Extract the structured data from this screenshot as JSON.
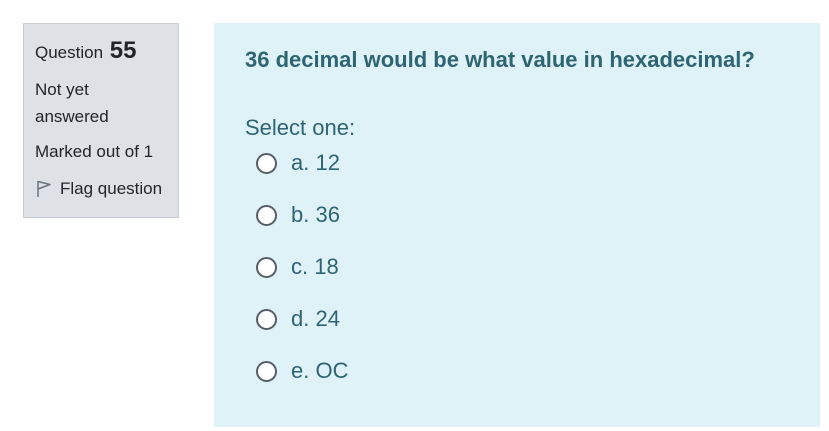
{
  "info": {
    "question_label": "Question",
    "question_number": "55",
    "state": "Not yet answered",
    "grade": "Marked out of 1",
    "flag_label": "Flag question"
  },
  "question": {
    "text": "36 decimal would be what value in hexadecimal?",
    "prompt": "Select one:",
    "options": [
      {
        "label": "a. 12"
      },
      {
        "label": "b. 36"
      },
      {
        "label": "c. 18"
      },
      {
        "label": "d. 24"
      },
      {
        "label": "e. OC"
      }
    ]
  },
  "colors": {
    "info_bg": "#dee2e6",
    "content_bg": "#def2f8",
    "text_accent": "#2f6473"
  }
}
